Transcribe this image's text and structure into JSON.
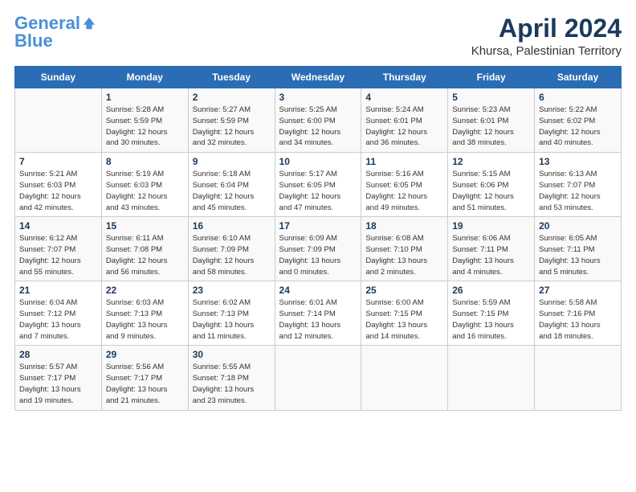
{
  "header": {
    "logo_line1": "General",
    "logo_line2": "Blue",
    "title": "April 2024",
    "subtitle": "Khursa, Palestinian Territory"
  },
  "weekdays": [
    "Sunday",
    "Monday",
    "Tuesday",
    "Wednesday",
    "Thursday",
    "Friday",
    "Saturday"
  ],
  "weeks": [
    [
      {
        "day": "",
        "info": ""
      },
      {
        "day": "1",
        "info": "Sunrise: 5:28 AM\nSunset: 5:59 PM\nDaylight: 12 hours\nand 30 minutes."
      },
      {
        "day": "2",
        "info": "Sunrise: 5:27 AM\nSunset: 5:59 PM\nDaylight: 12 hours\nand 32 minutes."
      },
      {
        "day": "3",
        "info": "Sunrise: 5:25 AM\nSunset: 6:00 PM\nDaylight: 12 hours\nand 34 minutes."
      },
      {
        "day": "4",
        "info": "Sunrise: 5:24 AM\nSunset: 6:01 PM\nDaylight: 12 hours\nand 36 minutes."
      },
      {
        "day": "5",
        "info": "Sunrise: 5:23 AM\nSunset: 6:01 PM\nDaylight: 12 hours\nand 38 minutes."
      },
      {
        "day": "6",
        "info": "Sunrise: 5:22 AM\nSunset: 6:02 PM\nDaylight: 12 hours\nand 40 minutes."
      }
    ],
    [
      {
        "day": "7",
        "info": "Sunrise: 5:21 AM\nSunset: 6:03 PM\nDaylight: 12 hours\nand 42 minutes."
      },
      {
        "day": "8",
        "info": "Sunrise: 5:19 AM\nSunset: 6:03 PM\nDaylight: 12 hours\nand 43 minutes."
      },
      {
        "day": "9",
        "info": "Sunrise: 5:18 AM\nSunset: 6:04 PM\nDaylight: 12 hours\nand 45 minutes."
      },
      {
        "day": "10",
        "info": "Sunrise: 5:17 AM\nSunset: 6:05 PM\nDaylight: 12 hours\nand 47 minutes."
      },
      {
        "day": "11",
        "info": "Sunrise: 5:16 AM\nSunset: 6:05 PM\nDaylight: 12 hours\nand 49 minutes."
      },
      {
        "day": "12",
        "info": "Sunrise: 5:15 AM\nSunset: 6:06 PM\nDaylight: 12 hours\nand 51 minutes."
      },
      {
        "day": "13",
        "info": "Sunrise: 6:13 AM\nSunset: 7:07 PM\nDaylight: 12 hours\nand 53 minutes."
      }
    ],
    [
      {
        "day": "14",
        "info": "Sunrise: 6:12 AM\nSunset: 7:07 PM\nDaylight: 12 hours\nand 55 minutes."
      },
      {
        "day": "15",
        "info": "Sunrise: 6:11 AM\nSunset: 7:08 PM\nDaylight: 12 hours\nand 56 minutes."
      },
      {
        "day": "16",
        "info": "Sunrise: 6:10 AM\nSunset: 7:09 PM\nDaylight: 12 hours\nand 58 minutes."
      },
      {
        "day": "17",
        "info": "Sunrise: 6:09 AM\nSunset: 7:09 PM\nDaylight: 13 hours\nand 0 minutes."
      },
      {
        "day": "18",
        "info": "Sunrise: 6:08 AM\nSunset: 7:10 PM\nDaylight: 13 hours\nand 2 minutes."
      },
      {
        "day": "19",
        "info": "Sunrise: 6:06 AM\nSunset: 7:11 PM\nDaylight: 13 hours\nand 4 minutes."
      },
      {
        "day": "20",
        "info": "Sunrise: 6:05 AM\nSunset: 7:11 PM\nDaylight: 13 hours\nand 5 minutes."
      }
    ],
    [
      {
        "day": "21",
        "info": "Sunrise: 6:04 AM\nSunset: 7:12 PM\nDaylight: 13 hours\nand 7 minutes."
      },
      {
        "day": "22",
        "info": "Sunrise: 6:03 AM\nSunset: 7:13 PM\nDaylight: 13 hours\nand 9 minutes."
      },
      {
        "day": "23",
        "info": "Sunrise: 6:02 AM\nSunset: 7:13 PM\nDaylight: 13 hours\nand 11 minutes."
      },
      {
        "day": "24",
        "info": "Sunrise: 6:01 AM\nSunset: 7:14 PM\nDaylight: 13 hours\nand 12 minutes."
      },
      {
        "day": "25",
        "info": "Sunrise: 6:00 AM\nSunset: 7:15 PM\nDaylight: 13 hours\nand 14 minutes."
      },
      {
        "day": "26",
        "info": "Sunrise: 5:59 AM\nSunset: 7:15 PM\nDaylight: 13 hours\nand 16 minutes."
      },
      {
        "day": "27",
        "info": "Sunrise: 5:58 AM\nSunset: 7:16 PM\nDaylight: 13 hours\nand 18 minutes."
      }
    ],
    [
      {
        "day": "28",
        "info": "Sunrise: 5:57 AM\nSunset: 7:17 PM\nDaylight: 13 hours\nand 19 minutes."
      },
      {
        "day": "29",
        "info": "Sunrise: 5:56 AM\nSunset: 7:17 PM\nDaylight: 13 hours\nand 21 minutes."
      },
      {
        "day": "30",
        "info": "Sunrise: 5:55 AM\nSunset: 7:18 PM\nDaylight: 13 hours\nand 23 minutes."
      },
      {
        "day": "",
        "info": ""
      },
      {
        "day": "",
        "info": ""
      },
      {
        "day": "",
        "info": ""
      },
      {
        "day": "",
        "info": ""
      }
    ]
  ]
}
